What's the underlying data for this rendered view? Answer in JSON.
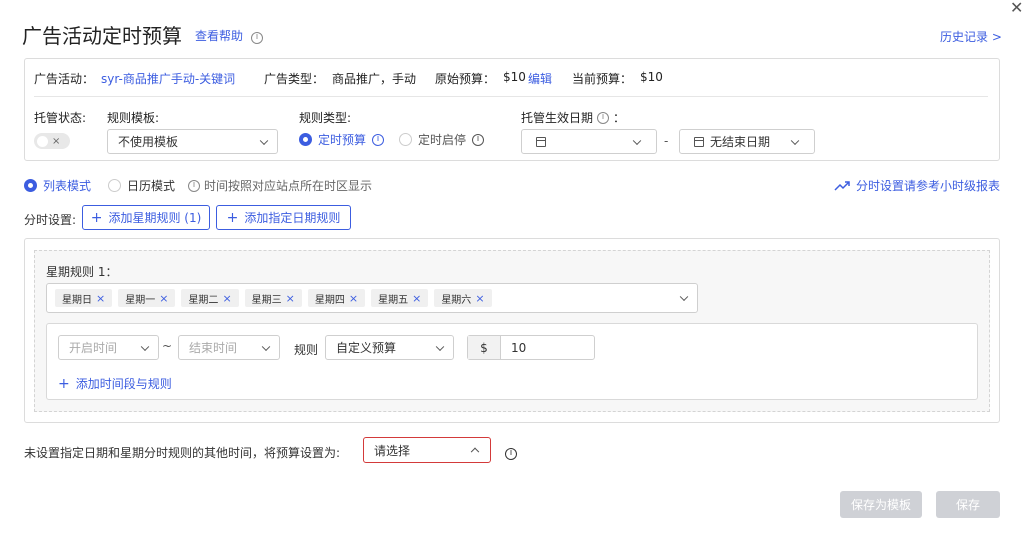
{
  "header": {
    "title": "广告活动定时预算",
    "help_link": "查看帮助",
    "history_link": "历史记录 >"
  },
  "summary": {
    "campaign_label": "广告活动：",
    "campaign_value": "syr-商品推广手动-关键词",
    "ad_type_label": "广告类型：",
    "ad_type_value": "商品推广，手动",
    "original_budget_label": "原始预算：",
    "original_budget_value": "$10",
    "edit_label": "编辑",
    "current_budget_label": "当前预算：",
    "current_budget_value": "$10"
  },
  "settings": {
    "hosting_status_label": "托管状态:",
    "toggle_x": "×",
    "rule_template_label": "规则模板:",
    "rule_template_value": "不使用模板",
    "rule_type_label": "规则类型:",
    "rule_type_option1": "定时预算",
    "rule_type_option2": "定时启停",
    "effective_date_label": "托管生效日期",
    "effective_date_suffix": "：",
    "date_separator": "-",
    "end_date_value": "无结束日期"
  },
  "mode": {
    "list_mode": "列表模式",
    "calendar_mode": "日历模式",
    "timezone_note": "时间按照对应站点所在时区显示",
    "report_link": "分时设置请参考小时级报表"
  },
  "schedule": {
    "label": "分时设置:",
    "add_week_rule": "添加星期规则 (1)",
    "add_date_rule": "添加指定日期规则"
  },
  "week_rule": {
    "title": "星期规则 1：",
    "days": [
      "星期日",
      "星期一",
      "星期二",
      "星期三",
      "星期四",
      "星期五",
      "星期六"
    ],
    "start_time_placeholder": "开启时间",
    "tilde": "~",
    "end_time_placeholder": "结束时间",
    "rule_label": "规则",
    "rule_value": "自定义预算",
    "currency": "$",
    "amount": "10",
    "add_time_rule": "添加时间段与规则"
  },
  "other_time": {
    "label": "未设置指定日期和星期分时规则的其他时间，将预算设置为:",
    "placeholder": "请选择"
  },
  "footer": {
    "save_template": "保存为模板",
    "save": "保存"
  },
  "close_glyph": "✕",
  "plus_glyph": "+",
  "colors": {
    "accent": "#3c5de0",
    "error_border": "#d33a3a",
    "disabled_button": "#cfd1d6"
  }
}
